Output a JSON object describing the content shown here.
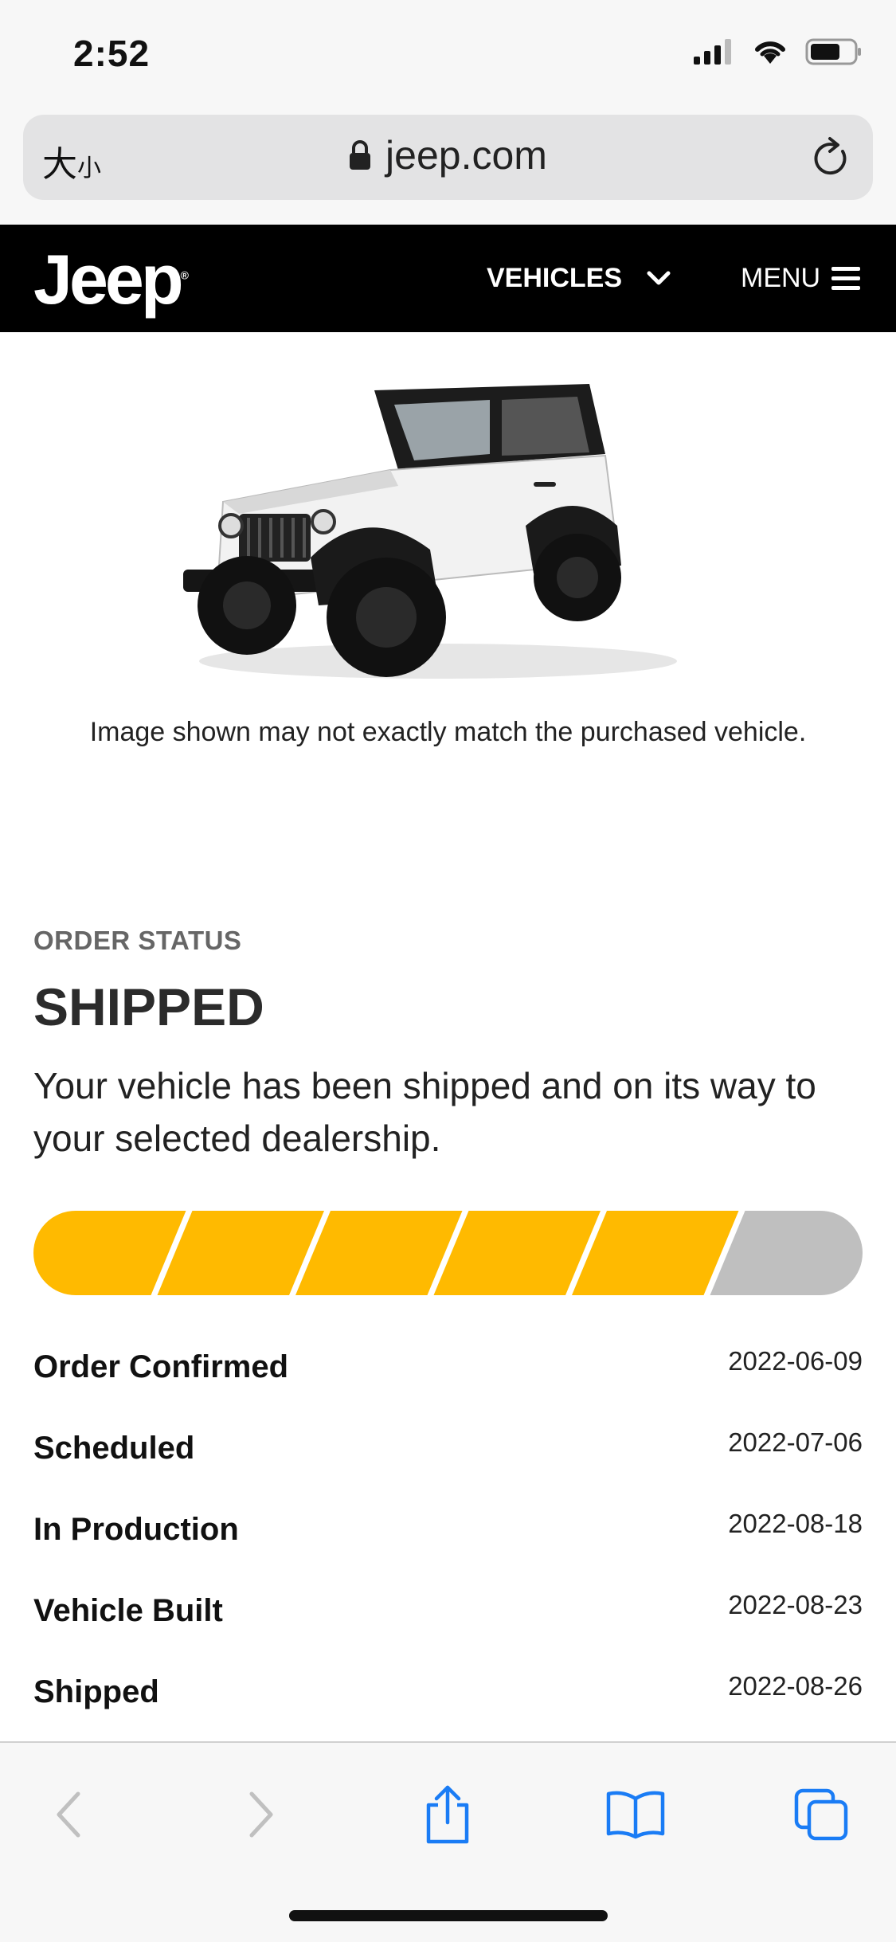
{
  "status_bar": {
    "time": "2:52"
  },
  "browser": {
    "text_size_big": "大",
    "text_size_small": "小",
    "url": "jeep.com"
  },
  "nav": {
    "logo": "Jeep",
    "vehicles_label": "VEHICLES",
    "menu_label": "MENU",
    "bg_color": "#000000"
  },
  "vehicle": {
    "disclaimer": "Image shown may not exactly match the purchased vehicle."
  },
  "order": {
    "label": "ORDER STATUS",
    "status": "SHIPPED",
    "description": "Your vehicle has been shipped and on its way to your selected dealership.",
    "progress": {
      "completed_steps": 5,
      "total_steps": 6,
      "complete_color": "#FFBA00",
      "pending_color": "#BFBFBF"
    },
    "milestones": [
      {
        "name": "Order Confirmed",
        "date": "2022-06-09"
      },
      {
        "name": "Scheduled",
        "date": "2022-07-06"
      },
      {
        "name": "In Production",
        "date": "2022-08-18"
      },
      {
        "name": "Vehicle Built",
        "date": "2022-08-23"
      },
      {
        "name": "Shipped",
        "date": "2022-08-26"
      }
    ]
  },
  "toolbar": {
    "icons": [
      "back-icon",
      "forward-icon",
      "share-icon",
      "bookmarks-icon",
      "tabs-icon"
    ],
    "accent": "#1a7cf5"
  }
}
